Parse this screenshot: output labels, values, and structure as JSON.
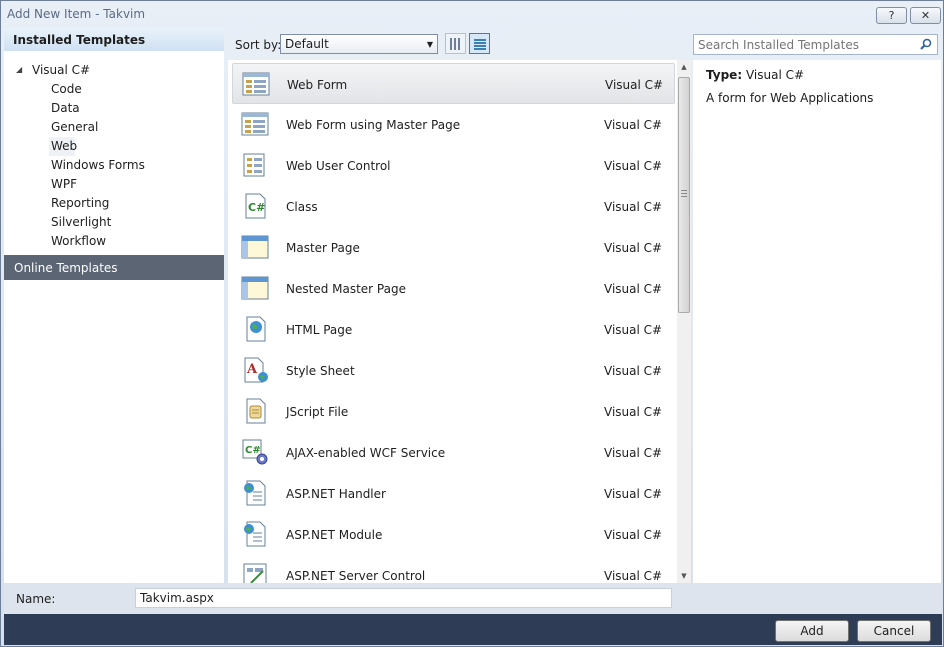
{
  "window": {
    "title": "Add New Item - Takvim",
    "help_label": "?",
    "close_label": "✕"
  },
  "left": {
    "installed_header": "Installed Templates",
    "root_label": "Visual C#",
    "items": [
      "Code",
      "Data",
      "General",
      "Web",
      "Windows Forms",
      "WPF",
      "Reporting",
      "Silverlight",
      "Workflow"
    ],
    "selected_item": "Web",
    "online_header": "Online Templates"
  },
  "toolbar": {
    "sort_label": "Sort by:",
    "sort_value": "Default"
  },
  "search": {
    "placeholder": "Search Installed Templates"
  },
  "templates": [
    {
      "name": "Web Form",
      "lang": "Visual C#",
      "icon": "web-form-icon",
      "selected": true
    },
    {
      "name": "Web Form using Master Page",
      "lang": "Visual C#",
      "icon": "web-form-master-icon"
    },
    {
      "name": "Web User Control",
      "lang": "Visual C#",
      "icon": "user-control-icon"
    },
    {
      "name": "Class",
      "lang": "Visual C#",
      "icon": "csharp-class-icon"
    },
    {
      "name": "Master Page",
      "lang": "Visual C#",
      "icon": "master-page-icon"
    },
    {
      "name": "Nested Master Page",
      "lang": "Visual C#",
      "icon": "nested-master-page-icon"
    },
    {
      "name": "HTML Page",
      "lang": "Visual C#",
      "icon": "html-page-icon"
    },
    {
      "name": "Style Sheet",
      "lang": "Visual C#",
      "icon": "style-sheet-icon"
    },
    {
      "name": "JScript File",
      "lang": "Visual C#",
      "icon": "jscript-file-icon"
    },
    {
      "name": "AJAX-enabled WCF Service",
      "lang": "Visual C#",
      "icon": "wcf-service-icon"
    },
    {
      "name": "ASP.NET Handler",
      "lang": "Visual C#",
      "icon": "aspnet-handler-icon"
    },
    {
      "name": "ASP.NET Module",
      "lang": "Visual C#",
      "icon": "aspnet-module-icon"
    },
    {
      "name": "ASP.NET Server Control",
      "lang": "Visual C#",
      "icon": "aspnet-server-control-icon"
    }
  ],
  "details": {
    "type_label": "Type:",
    "type_value": "Visual C#",
    "description": "A form for Web Applications"
  },
  "name_field": {
    "label": "Name:",
    "value": "Takvim.aspx"
  },
  "buttons": {
    "add": "Add",
    "cancel": "Cancel"
  }
}
